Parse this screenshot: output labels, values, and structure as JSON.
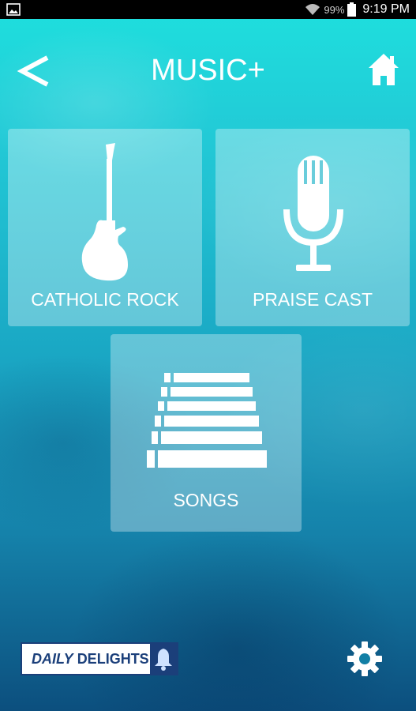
{
  "status_bar": {
    "battery_percent": "99%",
    "time": "9:19 PM"
  },
  "header": {
    "title": "MUSIC+",
    "back_icon": "back-chevron-icon",
    "home_icon": "home-icon"
  },
  "tiles": [
    {
      "label": "CATHOLIC ROCK",
      "icon": "electric-guitar-icon"
    },
    {
      "label": "PRAISE CAST",
      "icon": "microphone-icon"
    },
    {
      "label": "SONGS",
      "icon": "sheet-bars-icon"
    }
  ],
  "footer": {
    "daily_italic": "DAILY",
    "daily_rest": "DELIGHTS",
    "bell_icon": "bell-icon",
    "settings_icon": "gear-icon"
  },
  "colors": {
    "background_top": "#1ee0de",
    "background_bottom": "#0c4f7e",
    "badge_blue": "#1b3f7a"
  }
}
